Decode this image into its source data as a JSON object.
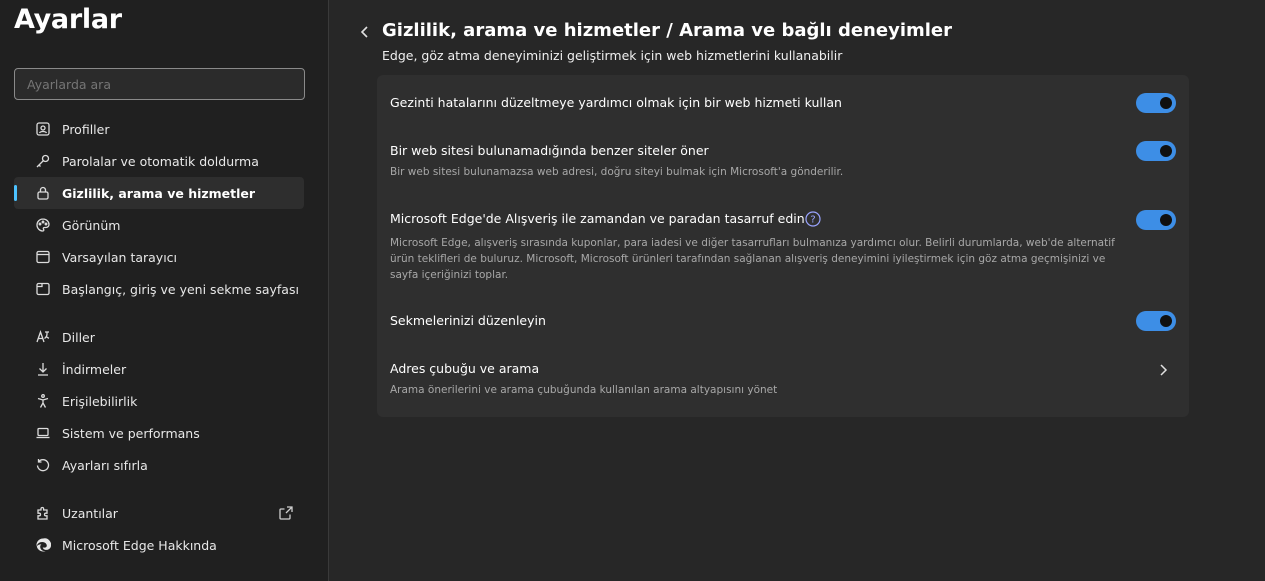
{
  "app_title": "Ayarlar",
  "search": {
    "placeholder": "Ayarlarda ara"
  },
  "sidebar": {
    "items": [
      {
        "label": "Profiller",
        "icon": "profile-icon"
      },
      {
        "label": "Parolalar ve otomatik doldurma",
        "icon": "key-icon"
      },
      {
        "label": "Gizlilik, arama ve hizmetler",
        "icon": "lock-icon",
        "active": true
      },
      {
        "label": "Görünüm",
        "icon": "palette-icon"
      },
      {
        "label": "Varsayılan tarayıcı",
        "icon": "browser-icon"
      },
      {
        "label": "Başlangıç, giriş ve yeni sekme sayfası",
        "icon": "home-page-icon"
      },
      {
        "label": "Diller",
        "icon": "language-icon"
      },
      {
        "label": "İndirmeler",
        "icon": "download-icon"
      },
      {
        "label": "Erişilebilirlik",
        "icon": "accessibility-icon"
      },
      {
        "label": "Sistem ve performans",
        "icon": "laptop-icon"
      },
      {
        "label": "Ayarları sıfırla",
        "icon": "reset-icon"
      },
      {
        "label": "Uzantılar",
        "icon": "puzzle-icon"
      },
      {
        "label": "Microsoft Edge Hakkında",
        "icon": "edge-icon"
      }
    ]
  },
  "header": {
    "title": "Gizlilik, arama ve hizmetler  /  Arama ve bağlı deneyimler",
    "subtitle": "Edge, göz atma deneyiminizi geliştirmek için web hizmetlerini kullanabilir"
  },
  "settings": [
    {
      "title": "Gezinti hatalarını düzeltmeye yardımcı olmak için bir web hizmeti kullan",
      "desc": "",
      "toggle": true
    },
    {
      "title": "Bir web sitesi bulunamadığında benzer siteler öner",
      "desc": "Bir web sitesi bulunamazsa web adresi, doğru siteyi bulmak için Microsoft'a gönderilir.",
      "toggle": true
    },
    {
      "title": "Microsoft Edge'de Alışveriş ile zamandan ve paradan tasarruf edin",
      "desc": "Microsoft Edge, alışveriş sırasında kuponlar, para iadesi ve diğer tasarrufları bulmanıza yardımcı olur. Belirli durumlarda, web'de alternatif ürün teklifleri de buluruz. Microsoft, Microsoft ürünleri tarafından sağlanan alışveriş deneyimini iyileştirmek için göz atma geçmişinizi ve sayfa içeriğinizi toplar.",
      "toggle": true
    },
    {
      "title": "Sekmelerinizi düzenleyin",
      "desc": "",
      "toggle": true
    },
    {
      "title": "Adres çubuğu ve arama",
      "desc": "Arama önerilerini ve arama çubuğunda kullanılan arama altyapısını yönet",
      "toggle": false
    }
  ],
  "colors": {
    "accent": "#3d8ee6",
    "active_indicator": "#4cc2ff"
  }
}
